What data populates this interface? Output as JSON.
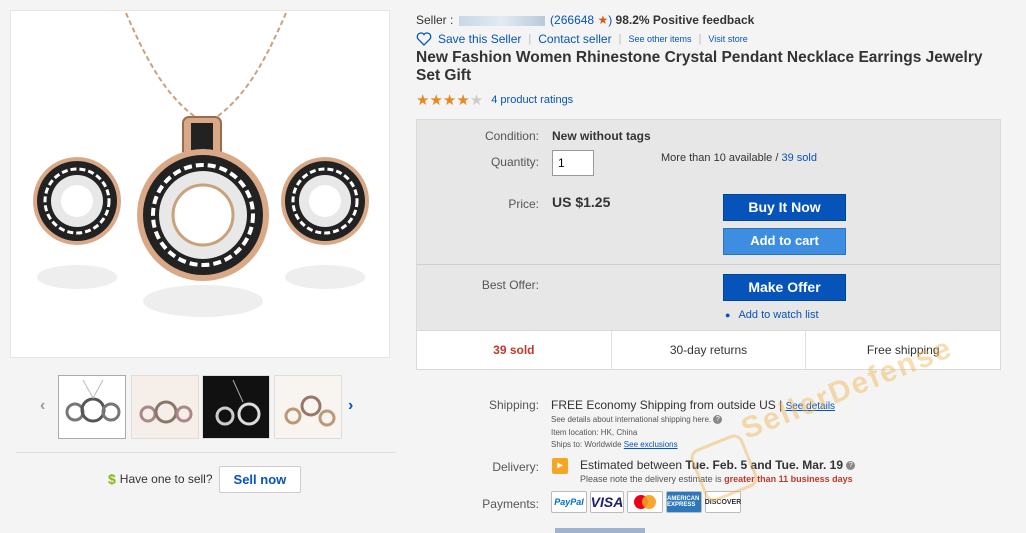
{
  "seller": {
    "prefix": "Seller :",
    "score": "(266648",
    "score_close": ")",
    "star": "★",
    "feedback": "98.2% Positive feedback"
  },
  "links": {
    "save": "Save this Seller",
    "contact": "Contact seller",
    "other_items": "See other items",
    "visit_store": "Visit store"
  },
  "item": {
    "title": "New Fashion Women Rhinestone Crystal Pendant Necklace Earrings Jewelry Set Gift",
    "rating_count": "4 product ratings",
    "stars": 4
  },
  "panel": {
    "condition_label": "Condition:",
    "condition_value": "New without tags",
    "quantity_label": "Quantity:",
    "quantity_value": "1",
    "available_text": "More than 10 available /",
    "sold_link": "39 sold",
    "price_label": "Price:",
    "price_value": "US $1.25",
    "buy_now": "Buy It Now",
    "add_to_cart": "Add to cart",
    "best_offer_label": "Best Offer:",
    "make_offer": "Make Offer",
    "watch_list": "Add to watch list",
    "info_sold": "39 sold",
    "info_returns": "30-day returns",
    "info_shipping": "Free shipping"
  },
  "shipping": {
    "label": "Shipping:",
    "main": "FREE  Economy Shipping from outside US |",
    "see_details": "See details",
    "intl_note": "See details about international shipping here.",
    "location": "Item location:  HK, China",
    "ships_to": "Ships to:  Worldwide",
    "exclusions": "See exclusions"
  },
  "delivery": {
    "label": "Delivery:",
    "prefix": "Estimated between",
    "dates": "Tue. Feb. 5 and Tue. Mar. 19",
    "note_prefix": "Please note the delivery estimate is",
    "note_warn": "greater than 11 business days"
  },
  "payments": {
    "label": "Payments:",
    "methods": [
      "PayPal",
      "VISA",
      "MasterCard",
      "AMERICAN EXPRESS",
      "DISCOVER"
    ]
  },
  "sell": {
    "dollar": "$",
    "prompt": "Have one to sell?",
    "button": "Sell now"
  },
  "watermark": "SellerDefense",
  "colors": {
    "link": "#0654ba",
    "buy_button": "#0654ba",
    "cart_button": "#3d8ee0",
    "sold": "#c0392b",
    "star": "#e58a1f"
  }
}
